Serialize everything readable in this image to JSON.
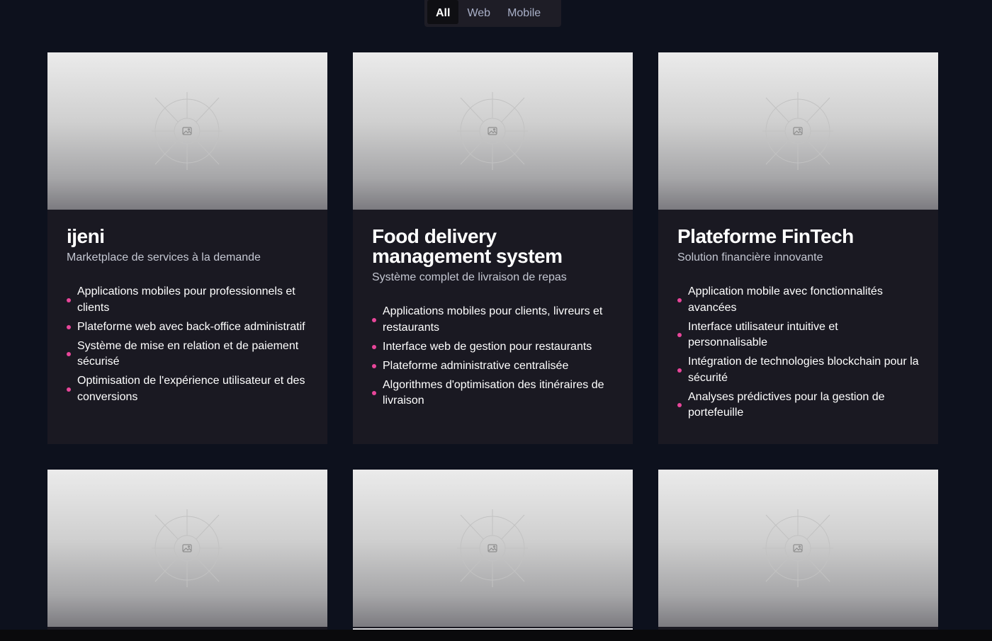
{
  "filters": {
    "tabs": [
      {
        "label": "All",
        "active": true
      },
      {
        "label": "Web",
        "active": false
      },
      {
        "label": "Mobile",
        "active": false
      }
    ]
  },
  "projects": [
    {
      "title": "ijeni",
      "subtitle": "Marketplace de services à la demande",
      "image_icon": "image-placeholder-icon",
      "features": [
        "Applications mobiles pour professionnels et clients",
        "Plateforme web avec back-office administratif",
        "Système de mise en relation et de paiement sécurisé",
        "Optimisation de l'expérience utilisateur et des conversions"
      ]
    },
    {
      "title": "Food delivery management system",
      "subtitle": "Système complet de livraison de repas",
      "image_icon": "image-placeholder-icon",
      "features": [
        "Applications mobiles pour clients, livreurs et restaurants",
        "Interface web de gestion pour restaurants",
        "Plateforme administrative centralisée",
        "Algorithmes d'optimisation des itinéraires de livraison"
      ]
    },
    {
      "title": "Plateforme FinTech",
      "subtitle": "Solution financière innovante",
      "image_icon": "image-placeholder-icon",
      "features": [
        "Application mobile avec fonctionnalités avancées",
        "Interface utilisateur intuitive et personnalisable",
        "Intégration de technologies blockchain pour la sécurité",
        "Analyses prédictives pour la gestion de portefeuille"
      ]
    }
  ],
  "colors": {
    "background": "#0d111d",
    "card": "#1a1922",
    "bullet_accent": "#e8469a"
  }
}
